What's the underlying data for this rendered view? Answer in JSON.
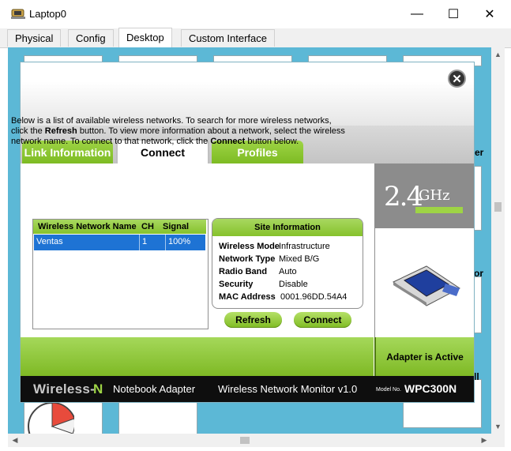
{
  "window": {
    "title": "Laptop0",
    "controls": {
      "minimize": "—",
      "maximize": "☐",
      "close": "✕"
    }
  },
  "tabs": [
    {
      "label": "Physical"
    },
    {
      "label": "Config"
    },
    {
      "label": "Desktop",
      "active": true
    },
    {
      "label": "Custom Interface"
    }
  ],
  "desktop_fragments": {
    "right_labels": [
      "er",
      "tor",
      "ll"
    ]
  },
  "wireless": {
    "tabs": [
      "Link Information",
      "Connect",
      "Profiles"
    ],
    "active_tab": "Connect",
    "intro": {
      "p1": "Below is a list of available wireless networks. To search for more wireless networks, click the ",
      "b1": "Refresh",
      "p2": " button. To view more information about a network, select the wireless network name. To connect to that network, click the ",
      "b2": "Connect",
      "p3": " button below."
    },
    "network_list": {
      "headers": [
        "Wireless Network Name",
        "CH",
        "Signal"
      ],
      "rows": [
        {
          "name": "Ventas",
          "ch": "1",
          "signal": "100%"
        }
      ]
    },
    "site_info": {
      "title": "Site Information",
      "fields": [
        {
          "label": "Wireless Mode",
          "value": "Infrastructure"
        },
        {
          "label": "Network Type",
          "value": "Mixed B/G"
        },
        {
          "label": "Radio Band",
          "value": "Auto"
        },
        {
          "label": "Security",
          "value": "Disable"
        },
        {
          "label": "MAC Address",
          "value": "0001.96DD.54A4"
        }
      ]
    },
    "buttons": {
      "refresh": "Refresh",
      "connect": "Connect"
    },
    "band": {
      "num": "2.4",
      "unit": "GHz"
    },
    "adapter_status": "Adapter is Active",
    "footer": {
      "brand_w": "Wireless-",
      "brand_n": "N",
      "brand_sub": "Notebook Adapter",
      "monitor": "Wireless Network Monitor  v1.0",
      "model_label": "Model No.",
      "model": "WPC300N"
    }
  },
  "colors": {
    "accent_green": "#8cc63f",
    "desktop_bg": "#5cb8d6",
    "selection": "#1e73d4"
  }
}
